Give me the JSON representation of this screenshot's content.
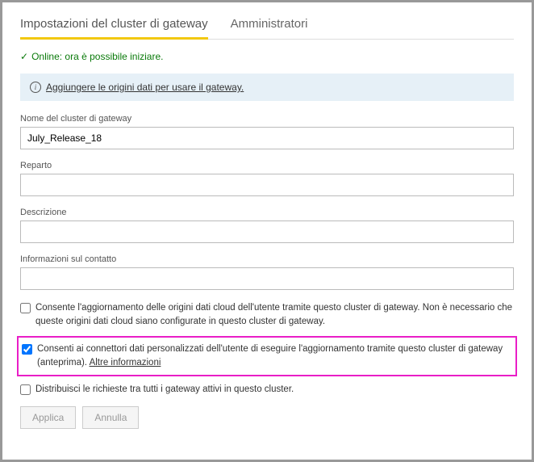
{
  "tabs": {
    "settings": "Impostazioni del cluster di gateway",
    "admins": "Amministratori"
  },
  "status": {
    "text": "Online: ora è possibile iniziare."
  },
  "banner": {
    "link": "Aggiungere le origini dati per usare il gateway."
  },
  "fields": {
    "cluster_name": {
      "label": "Nome del cluster di gateway",
      "value": "July_Release_18"
    },
    "department": {
      "label": "Reparto",
      "value": ""
    },
    "description": {
      "label": "Descrizione",
      "value": ""
    },
    "contact": {
      "label": "Informazioni sul contatto",
      "value": ""
    }
  },
  "checkboxes": {
    "allow_cloud": "Consente l'aggiornamento delle origini dati cloud dell'utente tramite questo cluster di gateway. Non è necessario che queste origini dati cloud siano configurate in questo cluster di gateway.",
    "allow_connectors_pre": "Consenti ai connettori dati personalizzati dell'utente di eseguire l'aggiornamento tramite questo cluster di gateway (anteprima). ",
    "allow_connectors_link": "Altre informazioni",
    "distribute": "Distribuisci le richieste tra tutti i gateway attivi in questo cluster."
  },
  "buttons": {
    "apply": "Applica",
    "cancel": "Annulla"
  }
}
